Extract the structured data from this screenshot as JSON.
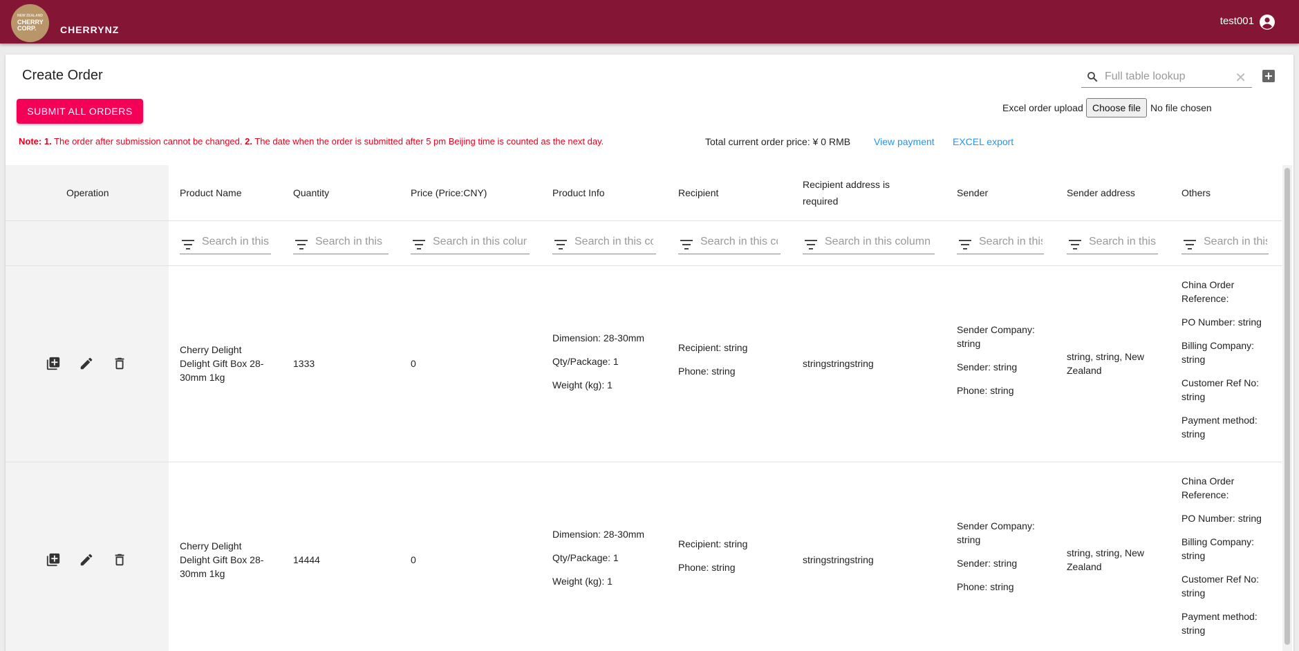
{
  "appbar": {
    "logo": {
      "line1": "NEW ZEALAND",
      "line2": "CHERRY",
      "line3": "CORP."
    },
    "brand": "CHERRYNZ",
    "username": "test001"
  },
  "page": {
    "title": "Create Order",
    "submit_label": "SUBMIT ALL ORDERS",
    "search_placeholder": "Full table lookup",
    "upload_label": "Excel order upload",
    "choose_file_label": "Choose file",
    "no_file_label": "No file chosen"
  },
  "note": {
    "prefix": "Note:",
    "n1": "1.",
    "t1": " The order after submission cannot be changed. ",
    "n2": "2.",
    "t2": " The date when the order is submitted after 5 pm Beijing time is counted as the next day."
  },
  "summary": {
    "total": "Total current order price: ¥ 0 RMB",
    "view_payment": "View payment",
    "excel_export": "EXCEL export"
  },
  "table": {
    "headers": {
      "operation": "Operation",
      "product_name": "Product Name",
      "quantity": "Quantity",
      "price": "Price (Price:CNY)",
      "product_info": "Product Info",
      "recipient": "Recipient",
      "recipient_address": "Recipient address is required",
      "sender": "Sender",
      "sender_address": "Sender address",
      "others": "Others"
    },
    "filters": {
      "product_name": "Search in this column",
      "quantity": "Search in this column",
      "price": "Search in this column",
      "product_info": "Search in this column",
      "recipient": "Search in this column",
      "recipient_address": "Search in this column",
      "sender": "Search in this column",
      "sender_address": "Search in this column",
      "others": "Search in this column"
    },
    "rows": [
      {
        "product_name": "Cherry Delight Delight Gift Box 28-30mm 1kg",
        "quantity": "1333",
        "price": "0",
        "info_dimension": "Dimension: 28-30mm",
        "info_qty": "Qty/Package: 1",
        "info_weight": "Weight (kg): 1",
        "recipient": "Recipient: string",
        "recipient_phone": "Phone: string",
        "recipient_address": "stringstringstring",
        "sender_company": "Sender Company: string",
        "sender": "Sender: string",
        "sender_phone": "Phone: string",
        "sender_address": "string, string, New Zealand",
        "china_ref": "China Order Reference:",
        "po": "PO Number: string",
        "billing": "Billing Company: string",
        "customer_ref": "Customer Ref No: string",
        "payment": "Payment method: string"
      },
      {
        "product_name": "Cherry Delight Delight Gift Box 28-30mm 1kg",
        "quantity": "14444",
        "price": "0",
        "info_dimension": "Dimension: 28-30mm",
        "info_qty": "Qty/Package: 1",
        "info_weight": "Weight (kg): 1",
        "recipient": "Recipient: string",
        "recipient_phone": "Phone: string",
        "recipient_address": "stringstringstring",
        "sender_company": "Sender Company: string",
        "sender": "Sender: string",
        "sender_phone": "Phone: string",
        "sender_address": "string, string, New Zealand",
        "china_ref": "China Order Reference:",
        "po": "PO Number: string",
        "billing": "Billing Company: string",
        "customer_ref": "Customer Ref No: string",
        "payment": "Payment method: string"
      }
    ]
  },
  "colors": {
    "appbar": "#851535",
    "accent": "#f50057",
    "note": "#e8001c",
    "link": "#2196f3"
  }
}
